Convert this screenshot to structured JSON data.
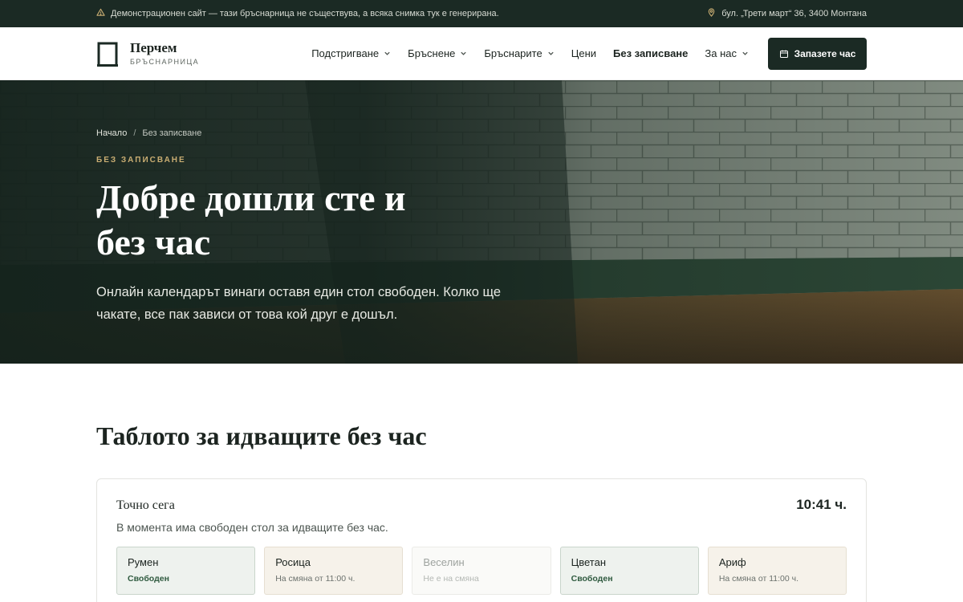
{
  "topbar": {
    "notice": "Демонстрационен сайт — тази бръснарница не съществува, а всяка снимка тук е генерирана.",
    "address": "бул. „Трети март“ 36, 3400 Монтана"
  },
  "brand": {
    "name": "Перчем",
    "subtitle": "БРЪСНАРНИЦА"
  },
  "nav": {
    "items": [
      {
        "label": "Подстригване",
        "has_dropdown": true
      },
      {
        "label": "Бръснене",
        "has_dropdown": true
      },
      {
        "label": "Бръснарите",
        "has_dropdown": true
      },
      {
        "label": "Цени",
        "has_dropdown": false
      },
      {
        "label": "Без записване",
        "has_dropdown": false,
        "active": true
      },
      {
        "label": "За нас",
        "has_dropdown": true
      }
    ],
    "cta_label": "Запазете час"
  },
  "hero": {
    "breadcrumb": {
      "home": "Начало",
      "separator": "/",
      "current": "Без записване"
    },
    "eyebrow": "БЕЗ ЗАПИСВАНЕ",
    "title_line1": "Добре дошли сте и",
    "title_line2": "без час",
    "lead": "Онлайн календарът винаги оставя един стол свободен. Колко ще чакате, все пак зависи от това кой друг е дошъл."
  },
  "board": {
    "heading": "Таблото за идващите без час",
    "label": "Точно сега",
    "time": "10:41 ч.",
    "status": "В момента има свободен стол за идващите без час.",
    "barbers": [
      {
        "name": "Румен",
        "state": "Свободен",
        "kind": "free"
      },
      {
        "name": "Росица",
        "state": "На смяна от 11:00 ч.",
        "kind": "shift"
      },
      {
        "name": "Веселин",
        "state": "Не е на смяна",
        "kind": "off"
      },
      {
        "name": "Цветан",
        "state": "Свободен",
        "kind": "free"
      },
      {
        "name": "Ариф",
        "state": "На смяна от 11:00 ч.",
        "kind": "shift"
      }
    ]
  },
  "colors": {
    "dark_green": "#1b2a24",
    "gold_accent": "#c9ad72",
    "free_green": "#2f5a3f"
  },
  "icons": {
    "notice": "warning-triangle-icon",
    "address": "map-pin-icon",
    "dropdown": "chevron-down-icon",
    "cta": "calendar-icon"
  }
}
